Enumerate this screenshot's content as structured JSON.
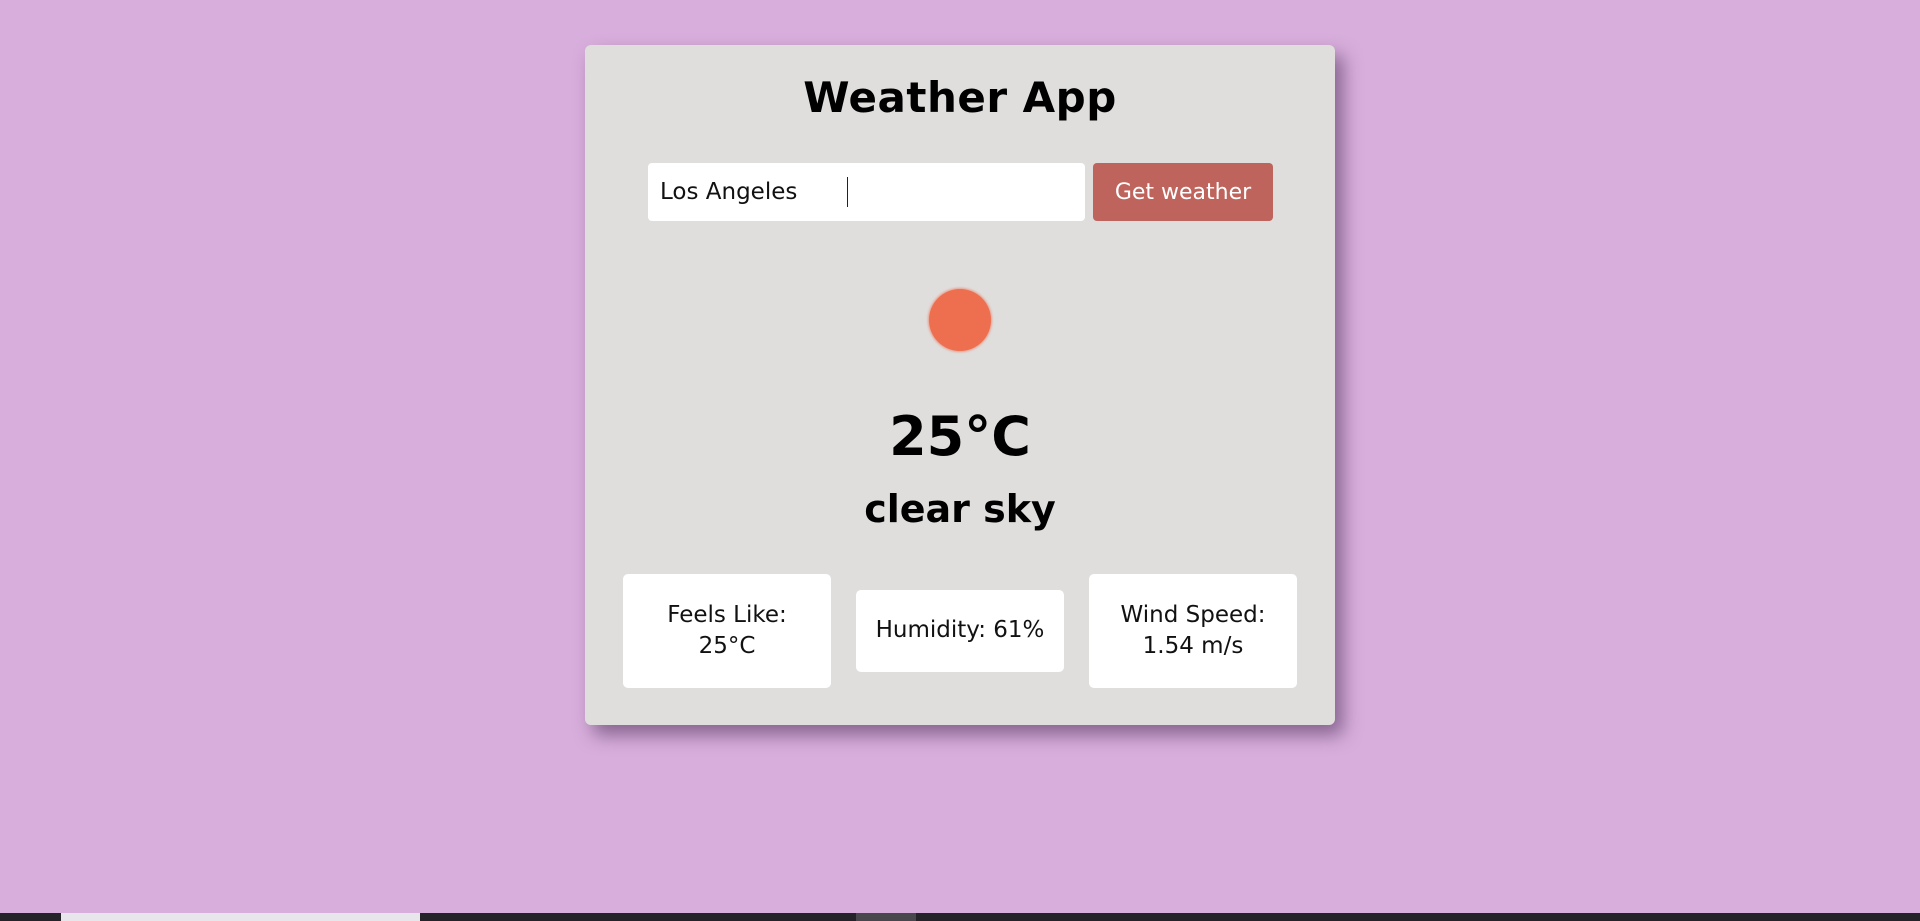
{
  "app": {
    "title": "Weather App"
  },
  "search": {
    "value": "Los Angeles",
    "button_label": "Get weather"
  },
  "weather": {
    "icon": "sun-icon",
    "temperature": "25°C",
    "description": "clear sky"
  },
  "stats": {
    "feels_like_label": "Feels Like:",
    "feels_like_value": "25°C",
    "humidity": "Humidity: 61%",
    "wind_speed_label": "Wind Speed:",
    "wind_speed_value": "1.54 m/s"
  },
  "colors": {
    "page_background": "#d8aedc",
    "card_background": "#dfdedd",
    "button_background": "#bf645c",
    "sun": "#ee6f4f"
  }
}
